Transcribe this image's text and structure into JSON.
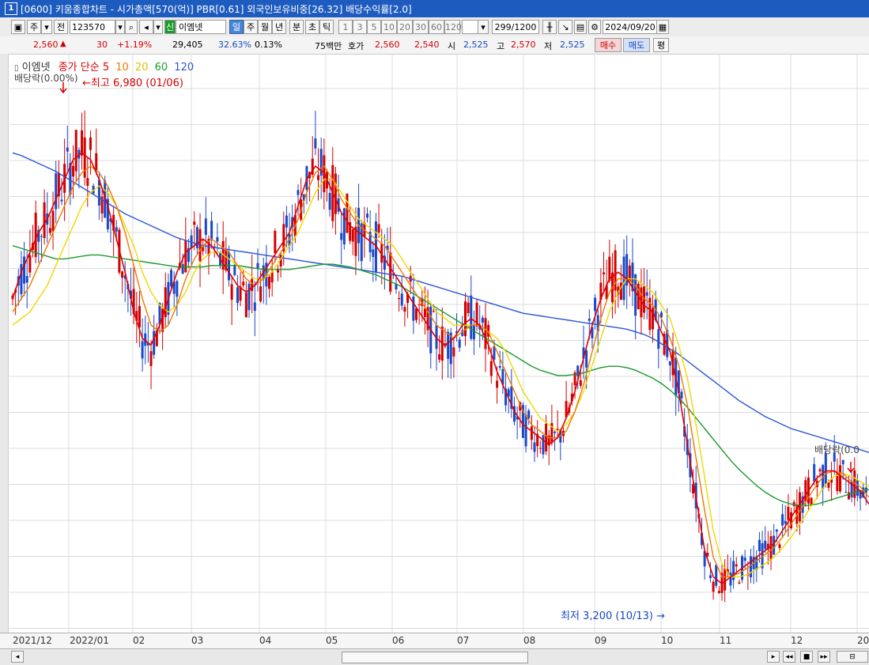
{
  "window": {
    "number": "1",
    "title": "[0600] 키움종합차트 - 시가총액[570(억)] PBR[0.61] 외국인보유비중[26.32] 배당수익률[2.0]"
  },
  "toolbar": {
    "market_type": "주",
    "prev_label": "전",
    "stock_code": "123570",
    "badge_label": "신",
    "stock_name": "이엠넷",
    "periods": [
      "일",
      "주",
      "월",
      "년",
      "분",
      "초",
      "틱"
    ],
    "selected_period": "일",
    "intervals": [
      "1",
      "3",
      "5",
      "10",
      "20",
      "30",
      "60",
      "120"
    ],
    "count": "299/1200",
    "date": "2024/09/20"
  },
  "info": {
    "price": "2,560",
    "change": "30",
    "change_pct": "+1.19%",
    "volume": "29,405",
    "vol_ratio": "32.63%",
    "turnover": "0.13%",
    "amount": "75백만",
    "quote_label": "호가",
    "ask": "2,560",
    "bid": "2,540",
    "open_label": "시",
    "open": "2,525",
    "high_label": "고",
    "high": "2,570",
    "low_label": "저",
    "low": "2,525",
    "buy_label": "매수",
    "sell_label": "매도",
    "flat_label": "평"
  },
  "chart_data": {
    "type": "line",
    "legend": {
      "stock": "이엠넷",
      "price_label": "종가",
      "ma_type": "단순",
      "periods": [
        "5",
        "10",
        "20",
        "60",
        "120"
      ]
    },
    "annotations": {
      "dividend_left": "배당락(0.00%)",
      "dividend_right": "배당락(0.0",
      "high": "최고 6,980 (01/06)",
      "low": "최저 3,200 (10/13)"
    },
    "x_labels": [
      "2021/12",
      "2022/01",
      "02",
      "03",
      "04",
      "05",
      "06",
      "07",
      "08",
      "09",
      "10",
      "11",
      "12",
      "20"
    ],
    "colors": {
      "up": "#d40000",
      "down": "#1a48c8",
      "ma5": "#e00000",
      "ma10": "#f07800",
      "ma20": "#f0d800",
      "ma60": "#1a9a2a",
      "ma120": "#2a55d8"
    },
    "ma_values": {
      "ma5": [
        5400,
        5600,
        5750,
        5900,
        6000,
        6150,
        6300,
        6450,
        6500,
        6450,
        6300,
        6100,
        5850,
        5600,
        5300,
        5100,
        5050,
        5200,
        5400,
        5600,
        5750,
        5800,
        5850,
        5800,
        5700,
        5600,
        5500,
        5450,
        5500,
        5600,
        5700,
        5800,
        5900,
        6100,
        6300,
        6400,
        6350,
        6200,
        6050,
        5950,
        5900,
        5850,
        5800,
        5700,
        5600,
        5500,
        5400,
        5300,
        5200,
        5100,
        5050,
        5100,
        5200,
        5250,
        5200,
        5050,
        4850,
        4700,
        4550,
        4450,
        4400,
        4350,
        4300,
        4350,
        4500,
        4700,
        4950,
        5200,
        5400,
        5550,
        5600,
        5550,
        5450,
        5350,
        5300,
        5150,
        5000,
        4700,
        4300,
        3900,
        3500,
        3300,
        3250,
        3300,
        3350,
        3400,
        3450,
        3500,
        3550,
        3650,
        3750,
        3850,
        3950,
        4050,
        4100,
        4100,
        4050,
        4000,
        3950,
        3850
      ],
      "ma10": [
        5300,
        5400,
        5500,
        5650,
        5800,
        5950,
        6100,
        6250,
        6350,
        6400,
        6350,
        6250,
        6100,
        5900,
        5650,
        5400,
        5200,
        5150,
        5200,
        5350,
        5550,
        5700,
        5800,
        5850,
        5800,
        5750,
        5650,
        5550,
        5500,
        5550,
        5650,
        5750,
        5850,
        6000,
        6200,
        6350,
        6400,
        6300,
        6150,
        6050,
        5950,
        5900,
        5850,
        5800,
        5700,
        5600,
        5500,
        5400,
        5300,
        5200,
        5150,
        5100,
        5150,
        5200,
        5200,
        5150,
        5000,
        4850,
        4700,
        4550,
        4450,
        4400,
        4350,
        4350,
        4400,
        4550,
        4750,
        5000,
        5250,
        5450,
        5550,
        5550,
        5500,
        5400,
        5350,
        5250,
        5100,
        4900,
        4600,
        4200,
        3800,
        3450,
        3300,
        3300,
        3330,
        3370,
        3420,
        3470,
        3520,
        3600,
        3700,
        3800,
        3900,
        4000,
        4080,
        4100,
        4080,
        4020,
        3980,
        3900
      ],
      "ma20": [
        5200,
        5250,
        5300,
        5400,
        5500,
        5650,
        5800,
        5950,
        6100,
        6200,
        6250,
        6200,
        6100,
        5950,
        5800,
        5600,
        5450,
        5350,
        5300,
        5350,
        5450,
        5600,
        5700,
        5750,
        5750,
        5700,
        5650,
        5600,
        5550,
        5550,
        5600,
        5700,
        5800,
        5900,
        6050,
        6200,
        6300,
        6300,
        6200,
        6100,
        6000,
        5950,
        5900,
        5850,
        5800,
        5700,
        5600,
        5500,
        5400,
        5300,
        5250,
        5200,
        5200,
        5200,
        5200,
        5150,
        5100,
        5000,
        4850,
        4700,
        4600,
        4500,
        4450,
        4400,
        4450,
        4550,
        4700,
        4900,
        5100,
        5300,
        5450,
        5550,
        5550,
        5500,
        5450,
        5350,
        5250,
        5050,
        4800,
        4450,
        4050,
        3650,
        3400,
        3300,
        3300,
        3320,
        3360,
        3400,
        3450,
        3520,
        3600,
        3700,
        3800,
        3900,
        4000,
        4060,
        4080,
        4060,
        4020,
        3980
      ],
      "ma60": [
        5800,
        5780,
        5760,
        5740,
        5720,
        5700,
        5700,
        5710,
        5720,
        5730,
        5730,
        5720,
        5710,
        5700,
        5690,
        5680,
        5670,
        5660,
        5650,
        5640,
        5640,
        5640,
        5640,
        5650,
        5650,
        5650,
        5650,
        5640,
        5630,
        5620,
        5620,
        5620,
        5620,
        5630,
        5640,
        5650,
        5660,
        5660,
        5650,
        5640,
        5620,
        5600,
        5580,
        5550,
        5520,
        5490,
        5450,
        5410,
        5370,
        5330,
        5290,
        5250,
        5210,
        5170,
        5130,
        5090,
        5050,
        5010,
        4970,
        4930,
        4890,
        4860,
        4840,
        4820,
        4820,
        4830,
        4840,
        4860,
        4880,
        4890,
        4890,
        4880,
        4860,
        4830,
        4800,
        4760,
        4710,
        4650,
        4580,
        4500,
        4420,
        4340,
        4260,
        4180,
        4110,
        4050,
        3990,
        3940,
        3900,
        3870,
        3850,
        3840,
        3840,
        3850,
        3870,
        3890,
        3910,
        3930,
        3950,
        3960
      ],
      "ma120": [
        6500,
        6480,
        6450,
        6420,
        6390,
        6360,
        6320,
        6280,
        6240,
        6200,
        6160,
        6120,
        6080,
        6040,
        6010,
        5980,
        5950,
        5920,
        5890,
        5860,
        5840,
        5820,
        5800,
        5790,
        5780,
        5770,
        5760,
        5750,
        5740,
        5730,
        5720,
        5710,
        5700,
        5690,
        5680,
        5670,
        5660,
        5650,
        5640,
        5630,
        5620,
        5610,
        5600,
        5590,
        5580,
        5570,
        5550,
        5530,
        5510,
        5490,
        5470,
        5450,
        5430,
        5410,
        5390,
        5370,
        5350,
        5330,
        5310,
        5290,
        5280,
        5270,
        5260,
        5250,
        5240,
        5230,
        5220,
        5210,
        5200,
        5190,
        5180,
        5170,
        5150,
        5130,
        5100,
        5060,
        5020,
        4980,
        4930,
        4880,
        4830,
        4780,
        4730,
        4680,
        4630,
        4590,
        4550,
        4510,
        4480,
        4450,
        4420,
        4400,
        4380,
        4360,
        4340,
        4320,
        4300,
        4280,
        4260,
        4240
      ]
    },
    "y_range": [
      3000,
      7200
    ]
  }
}
